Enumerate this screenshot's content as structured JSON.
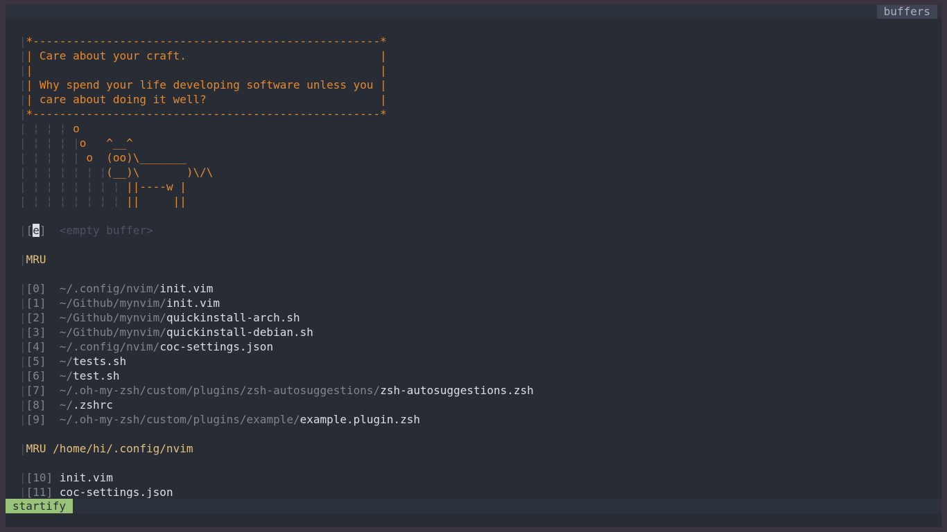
{
  "tabline": {
    "active_tab": "buffers"
  },
  "header": {
    "box_top": "*----------------------------------------------------*",
    "line1": "| Care about your craft.                             |",
    "line2": "|                                                    |",
    "line3": "| Why spend your life developing software unless you |",
    "line4": "| care about doing it well?                          |",
    "box_bottom": "*----------------------------------------------------*",
    "cow": [
      {
        "guides": " ¦ ¦ ¦ ",
        "text": "o"
      },
      {
        "guides": " ¦ ¦ ¦ |",
        "text": "o   ^__^"
      },
      {
        "guides": " ¦ ¦ ¦ | ",
        "text": "o  (oo)\\_______"
      },
      {
        "guides": " ¦ ¦ ¦ ¦ ¦ ¦",
        "text": "(__)\\       )\\/\\"
      },
      {
        "guides": " ¦ ¦ ¦ ¦ ¦ ¦ ¦ ",
        "text": "||----w |"
      },
      {
        "guides": " ¦ ¦ ¦ ¦ ¦ ¦ ¦ ",
        "text": "||     ||"
      }
    ]
  },
  "empty_buffer": {
    "key_open": "[",
    "key": "e",
    "key_close": "]",
    "label": "<empty buffer>"
  },
  "sections": [
    {
      "title": "MRU",
      "items": [
        {
          "index": "[0]",
          "dir": "~/.config/nvim/",
          "file": "init.vim"
        },
        {
          "index": "[1]",
          "dir": "~/Github/mynvim/",
          "file": "init.vim"
        },
        {
          "index": "[2]",
          "dir": "~/Github/mynvim/",
          "file": "quickinstall-arch.sh"
        },
        {
          "index": "[3]",
          "dir": "~/Github/mynvim/",
          "file": "quickinstall-debian.sh"
        },
        {
          "index": "[4]",
          "dir": "~/.config/nvim/",
          "file": "coc-settings.json"
        },
        {
          "index": "[5]",
          "dir": "~/",
          "file": "tests.sh"
        },
        {
          "index": "[6]",
          "dir": "~/",
          "file": "test.sh"
        },
        {
          "index": "[7]",
          "dir": "~/.oh-my-zsh/custom/plugins/zsh-autosuggestions/",
          "file": "zsh-autosuggestions.zsh"
        },
        {
          "index": "[8]",
          "dir": "~/",
          "file": ".zshrc"
        },
        {
          "index": "[9]",
          "dir": "~/.oh-my-zsh/custom/plugins/example/",
          "file": "example.plugin.zsh"
        }
      ]
    },
    {
      "title": "MRU /home/hi/.config/nvim",
      "items": [
        {
          "index": "[10]",
          "dir": "",
          "file": "init.vim"
        },
        {
          "index": "[11]",
          "dir": "",
          "file": "coc-settings.json"
        }
      ]
    }
  ],
  "statusline": {
    "mode": "startify"
  },
  "colors": {
    "background": "#282c34",
    "header_orange": "#e5892d",
    "section_yellow": "#e5c07b",
    "mode_green": "#98c379"
  }
}
